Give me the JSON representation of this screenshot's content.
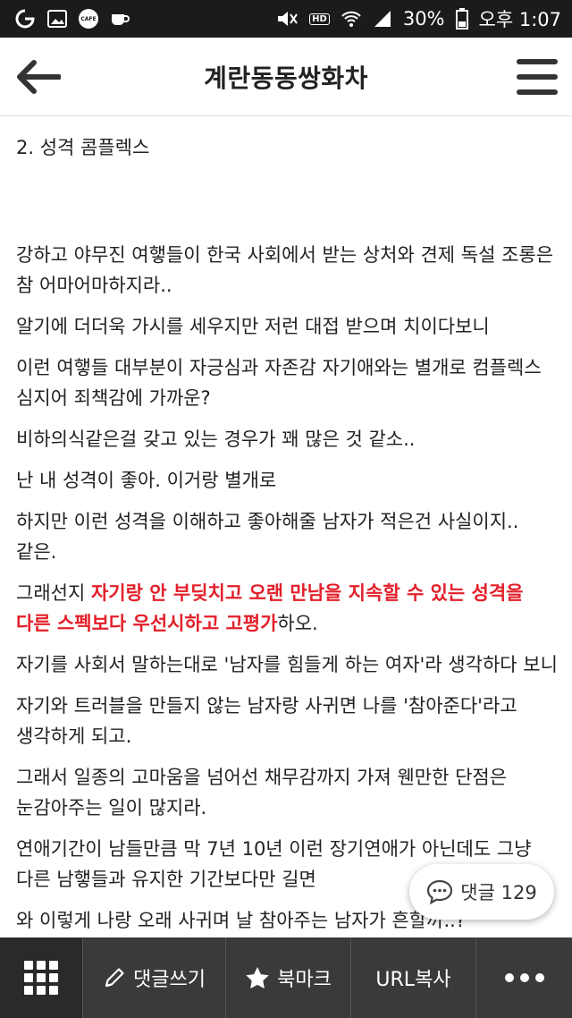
{
  "status_bar": {
    "battery": "30%",
    "time": "오후 1:07",
    "hd": "HD",
    "cafe": "CAFE"
  },
  "header": {
    "title": "계란동동쌍화차"
  },
  "article": {
    "heading": "2. 성격 콤플렉스",
    "paragraphs": [
      "강하고 야무진 여햏들이 한국 사회에서 받는 상처와 견제 독설 조롱은 참 어마어마하지라..",
      "알기에 더더욱 가시를 세우지만 저런 대접 받으며 치이다보니",
      "이런 여햏들 대부분이 자긍심과 자존감 자기애와는 별개로  컴플렉스 심지어 죄책감에 가까운?",
      "비하의식같은걸 갖고 있는 경우가 꽤 많은 것 같소..",
      "난 내 성격이 좋아. 이거랑 별개로",
      "하지만 이런 성격을 이해하고 좋아해줄 남자가 적은건 사실이지..같은."
    ],
    "highlight_para": {
      "before": "그래선지 ",
      "highlight": "자기랑 안 부딪치고 오랜 만남을 지속할 수 있는 성격을 다른 스펙보다 우선시하고 고평가",
      "after": "하오."
    },
    "paragraphs2": [
      "자기를 사회서 말하는대로 '남자를 힘들게 하는 여자'라 생각하다 보니",
      "자기와 트러블을 만들지 않는 남자랑 사귀면 나를 '참아준다'라고 생각하게 되고.",
      "그래서 일종의 고마움을 넘어선 채무감까지 가져 웬만한 단점은 눈감아주는 일이 많지라.",
      "연애기간이 남들만큼 막 7년 10년 이런 장기연애가 아닌데도 그냥 다른 남햏들과 유지한 기간보다만 길면",
      "와 이렇게 나랑 오래 사귀며 날 참아주는 남자가 흔할까..?"
    ]
  },
  "comment_button": {
    "label": "댓글 129"
  },
  "bottom_bar": {
    "write_comment": "댓글쓰기",
    "bookmark": "북마크",
    "copy_url": "URL복사"
  }
}
